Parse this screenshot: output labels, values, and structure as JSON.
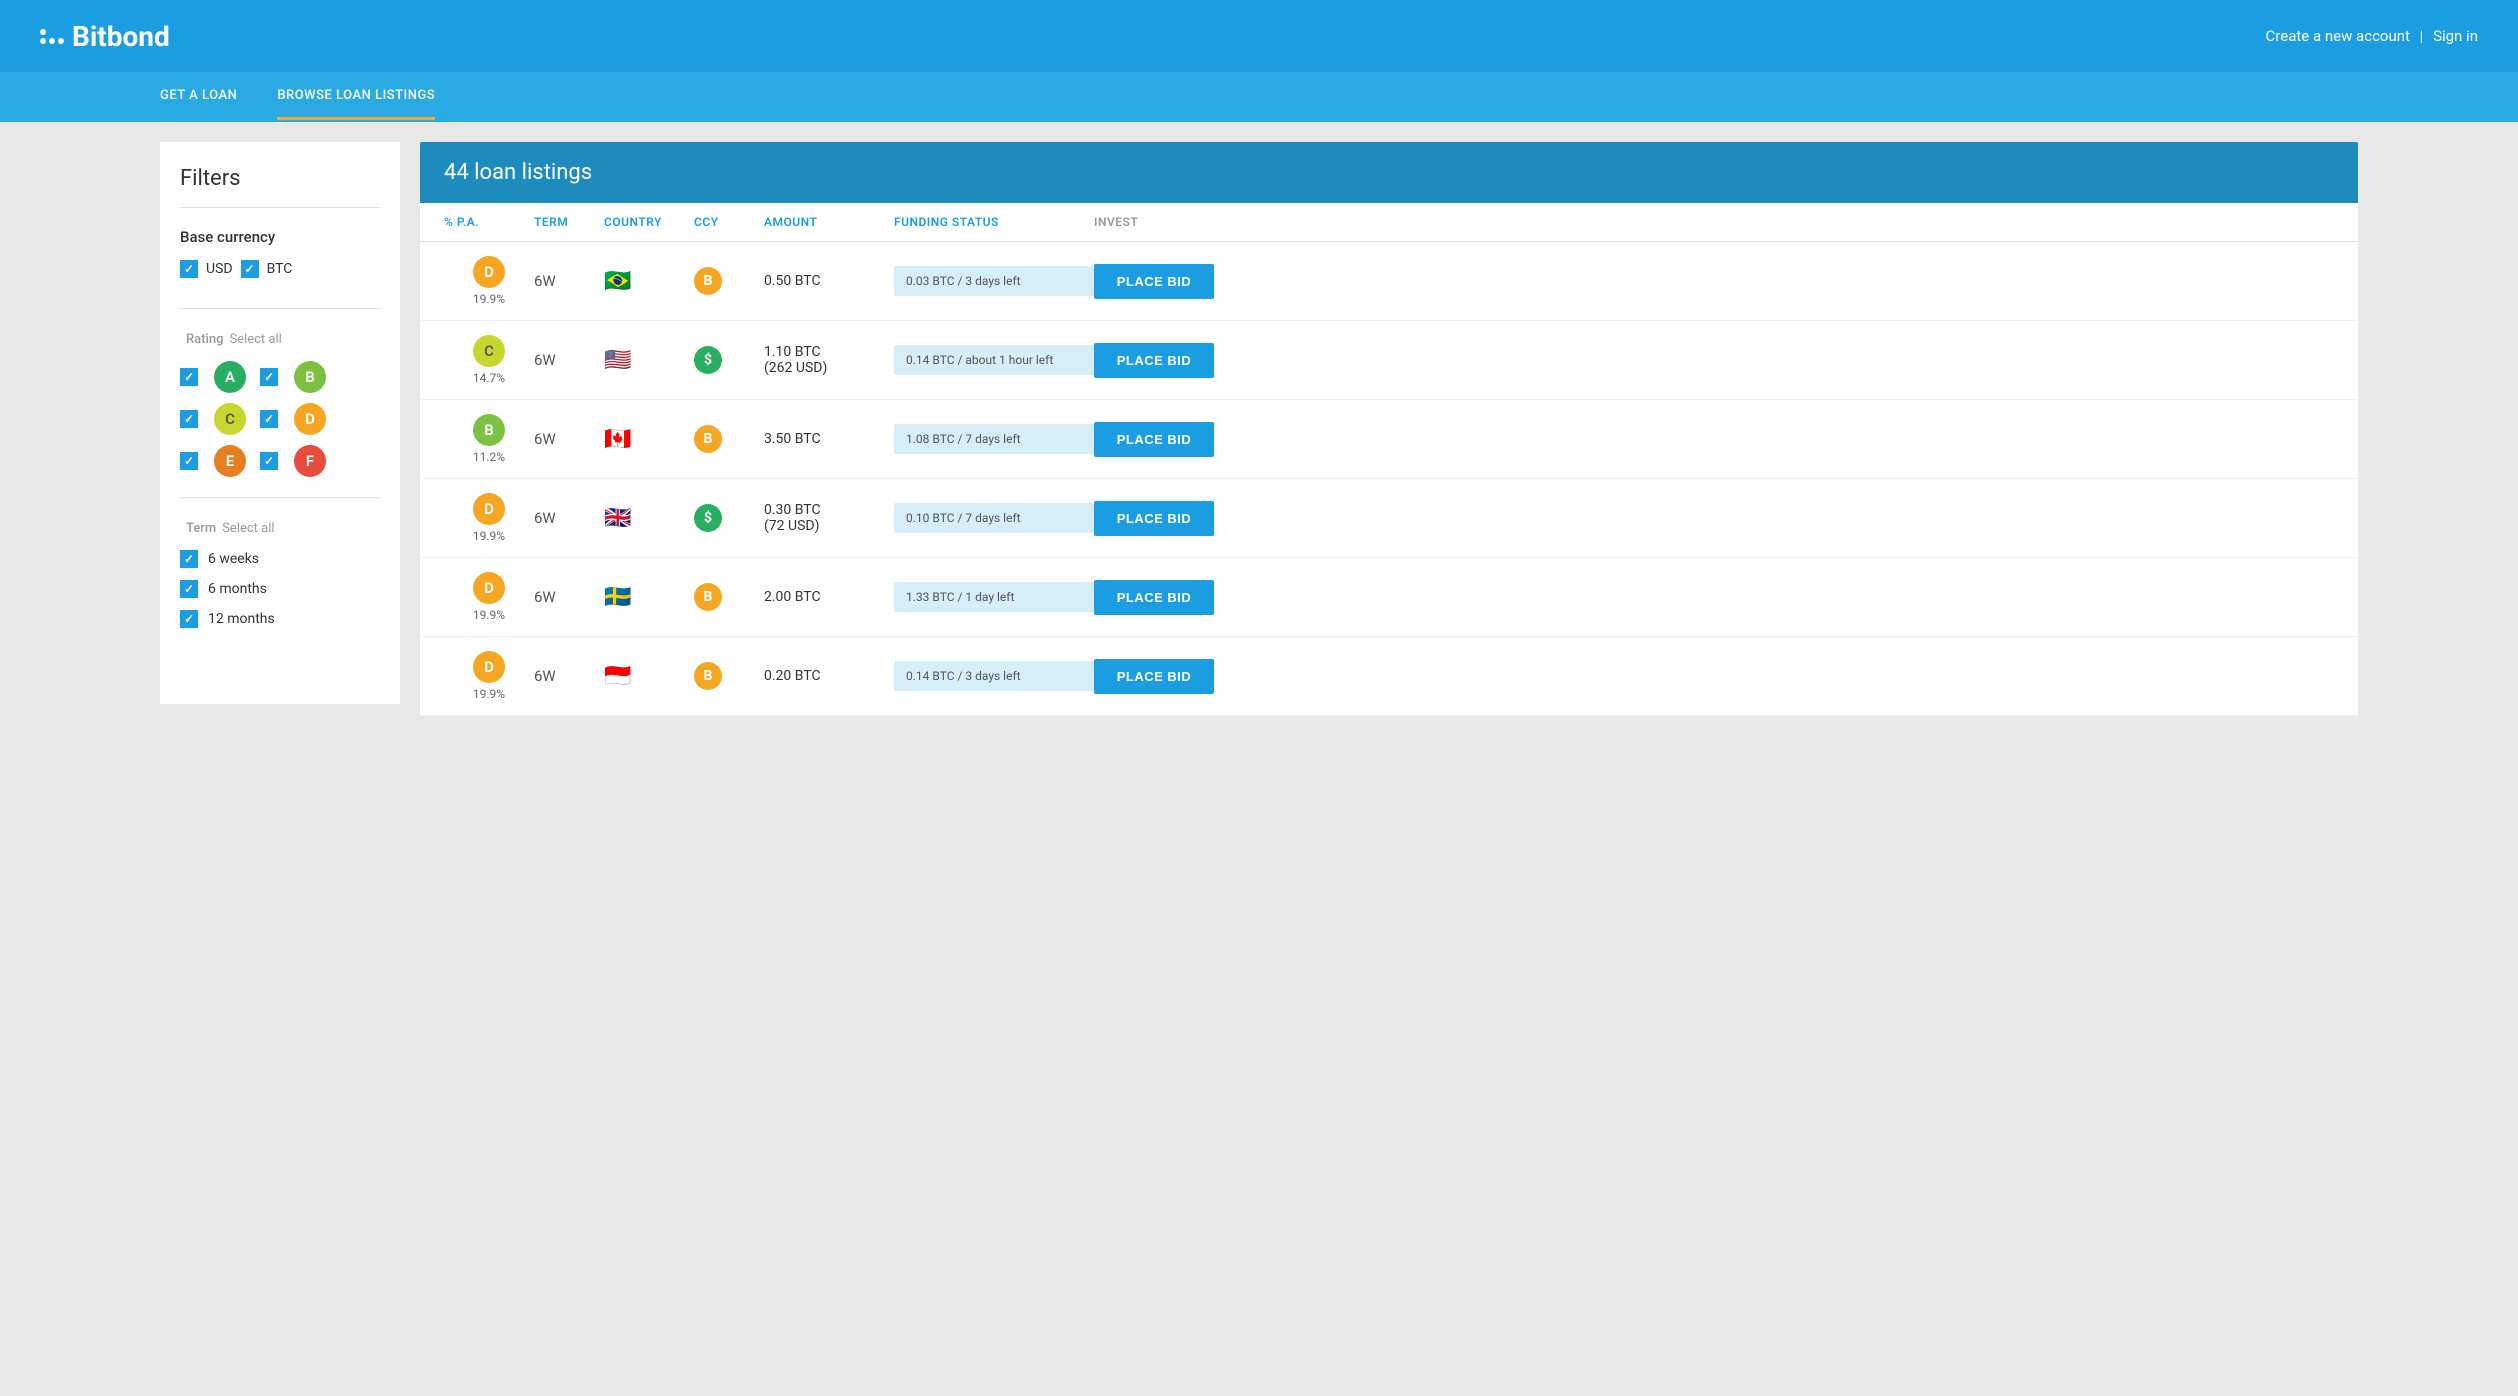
{
  "header": {
    "logo_text": "Bitbond",
    "auth_links": "Create a new account | Sign in",
    "create_account": "Create a new account",
    "separator": "|",
    "sign_in": "Sign in"
  },
  "nav": {
    "items": [
      {
        "id": "get-loan",
        "label": "GET A LOAN",
        "active": false
      },
      {
        "id": "browse-listings",
        "label": "BROWSE LOAN LISTINGS",
        "active": true
      }
    ]
  },
  "filters": {
    "title": "Filters",
    "base_currency": {
      "title": "Base currency",
      "options": [
        {
          "id": "usd",
          "label": "USD",
          "checked": true
        },
        {
          "id": "btc",
          "label": "BTC",
          "checked": true
        }
      ]
    },
    "rating": {
      "title": "Rating",
      "select_all": "Select all",
      "grades": [
        {
          "id": "a",
          "label": "A",
          "color": "badge-a",
          "checked": true
        },
        {
          "id": "b",
          "label": "B",
          "color": "badge-b",
          "checked": true
        },
        {
          "id": "c",
          "label": "C",
          "color": "badge-c",
          "checked": true
        },
        {
          "id": "d",
          "label": "D",
          "color": "badge-d",
          "checked": true
        },
        {
          "id": "e",
          "label": "E",
          "color": "badge-e",
          "checked": true
        },
        {
          "id": "f",
          "label": "F",
          "color": "badge-f",
          "checked": true
        }
      ]
    },
    "term": {
      "title": "Term",
      "select_all": "Select all",
      "options": [
        {
          "id": "6w",
          "label": "6 weeks",
          "checked": true
        },
        {
          "id": "6m",
          "label": "6 months",
          "checked": true
        },
        {
          "id": "12m",
          "label": "12 months",
          "checked": true
        }
      ]
    }
  },
  "listings": {
    "title": "44 loan listings",
    "columns": [
      {
        "id": "pct",
        "label": "% P.A.",
        "style": "blue"
      },
      {
        "id": "term",
        "label": "TERM",
        "style": "blue"
      },
      {
        "id": "country",
        "label": "COUNTRY",
        "style": "blue"
      },
      {
        "id": "ccy",
        "label": "CCY",
        "style": "blue"
      },
      {
        "id": "amount",
        "label": "AMOUNT",
        "style": "blue"
      },
      {
        "id": "funding_status",
        "label": "FUNDING STATUS",
        "style": "blue"
      },
      {
        "id": "invest",
        "label": "INVEST",
        "style": "gray"
      }
    ],
    "rows": [
      {
        "rating": "D",
        "rating_color": "badge-d",
        "pct": "19.9%",
        "term": "6W",
        "country_flag": "🇧🇷",
        "ccy": "B",
        "ccy_type": "ccy-btc",
        "amount": "0.50 BTC",
        "amount2": "",
        "funding": "0.03 BTC / 3 days left",
        "bid_label": "PLACE BID"
      },
      {
        "rating": "C",
        "rating_color": "badge-c",
        "pct": "14.7%",
        "term": "6W",
        "country_flag": "🇺🇸",
        "ccy": "$",
        "ccy_type": "ccy-usd",
        "amount": "1.10 BTC",
        "amount2": "(262 USD)",
        "funding": "0.14 BTC / about 1 hour left",
        "bid_label": "PLACE BID"
      },
      {
        "rating": "B",
        "rating_color": "badge-b",
        "pct": "11.2%",
        "term": "6W",
        "country_flag": "🇨🇦",
        "ccy": "B",
        "ccy_type": "ccy-btc",
        "amount": "3.50 BTC",
        "amount2": "",
        "funding": "1.08 BTC / 7 days left",
        "bid_label": "PLACE BID"
      },
      {
        "rating": "D",
        "rating_color": "badge-d",
        "pct": "19.9%",
        "term": "6W",
        "country_flag": "🇬🇧",
        "ccy": "$",
        "ccy_type": "ccy-usd",
        "amount": "0.30 BTC",
        "amount2": "(72 USD)",
        "funding": "0.10 BTC / 7 days left",
        "bid_label": "PLACE BID"
      },
      {
        "rating": "D",
        "rating_color": "badge-d",
        "pct": "19.9%",
        "term": "6W",
        "country_flag": "🇸🇪",
        "ccy": "B",
        "ccy_type": "ccy-btc",
        "amount": "2.00 BTC",
        "amount2": "",
        "funding": "1.33 BTC / 1 day left",
        "bid_label": "PLACE BID"
      },
      {
        "rating": "D",
        "rating_color": "badge-d",
        "pct": "19.9%",
        "term": "6W",
        "country_flag": "🇮🇩",
        "ccy": "B",
        "ccy_type": "ccy-btc",
        "amount": "0.20 BTC",
        "amount2": "",
        "funding": "0.14 BTC / 3 days left",
        "bid_label": "PLACE BID"
      }
    ]
  }
}
